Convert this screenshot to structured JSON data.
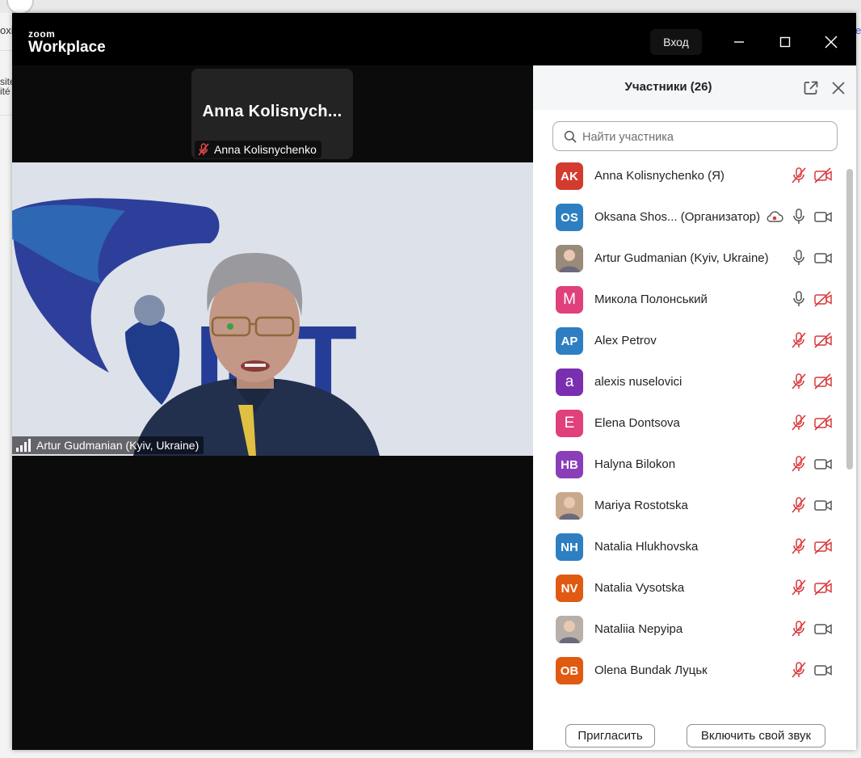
{
  "background_page": {
    "left_snippet_1": "oxi",
    "left_snippet_2": "site",
    "left_snippet_3": "ité",
    "right_snippet_1": "e"
  },
  "window": {
    "logo_top": "zoom",
    "logo_bottom": "Workplace",
    "signin_label": "Вход",
    "controls": [
      "minimize-icon",
      "maximize-icon",
      "close-icon"
    ]
  },
  "thumbnail": {
    "display_name": "Anna  Kolisnych...",
    "label": "Anna Kolisnychenko"
  },
  "main_video": {
    "speaker_label": "Artur Gudmanian (Kyiv, Ukraine)",
    "background_logo_text": "ІКТ"
  },
  "panel": {
    "title": "Участники (26)",
    "search_placeholder": "Найти участника",
    "invite_label": "Пригласить",
    "unmute_label": "Включить свой звук"
  },
  "participants": [
    {
      "initials": "AK",
      "name": "Anna Kolisnychenko (Я)",
      "color": "#d33b2f",
      "mic": "muted",
      "video": "off",
      "recording": false
    },
    {
      "initials": "OS",
      "name": "Oksana Shos... (Организатор)",
      "color": "#2d7fc1",
      "mic": "on",
      "video": "on",
      "recording": true
    },
    {
      "initials": "",
      "name": "Artur Gudmanian (Kyiv, Ukraine)",
      "color": "#9a8a7a",
      "photo": true,
      "mic": "on",
      "video": "on",
      "recording": false
    },
    {
      "initials": "М",
      "name": "Микола Полонський",
      "color": "#e0407b",
      "mic": "on",
      "video": "off",
      "recording": false
    },
    {
      "initials": "AP",
      "name": "Alex Petrov",
      "color": "#2d7fc1",
      "mic": "muted",
      "video": "off",
      "recording": false
    },
    {
      "initials": "a",
      "name": "alexis nuselovici",
      "color": "#7a2fb0",
      "mic": "muted",
      "video": "off",
      "recording": false
    },
    {
      "initials": "E",
      "name": "Elena Dontsova",
      "color": "#e0407b",
      "mic": "muted",
      "video": "off",
      "recording": false
    },
    {
      "initials": "HB",
      "name": "Halyna Bilokon",
      "color": "#8a3fb8",
      "mic": "muted",
      "video": "on",
      "recording": false
    },
    {
      "initials": "",
      "name": "Mariya Rostotska",
      "color": "#c9a98d",
      "photo": true,
      "mic": "muted",
      "video": "on",
      "recording": false
    },
    {
      "initials": "NH",
      "name": "Natalia Hlukhovska",
      "color": "#2d7fc1",
      "mic": "muted",
      "video": "off",
      "recording": false
    },
    {
      "initials": "NV",
      "name": "Natalia Vysotska",
      "color": "#e05a12",
      "mic": "muted",
      "video": "off",
      "recording": false
    },
    {
      "initials": "",
      "name": "Nataliia Nepyipa",
      "color": "#b8b0a8",
      "photo": true,
      "mic": "muted",
      "video": "on",
      "recording": false
    },
    {
      "initials": "OB",
      "name": "Olena Bundak Луцьк",
      "color": "#e05a12",
      "mic": "muted",
      "video": "on",
      "recording": false
    }
  ],
  "colors": {
    "muted_red": "#d9383a",
    "icon_gray": "#555555",
    "window_bg": "#0b0b0b"
  }
}
